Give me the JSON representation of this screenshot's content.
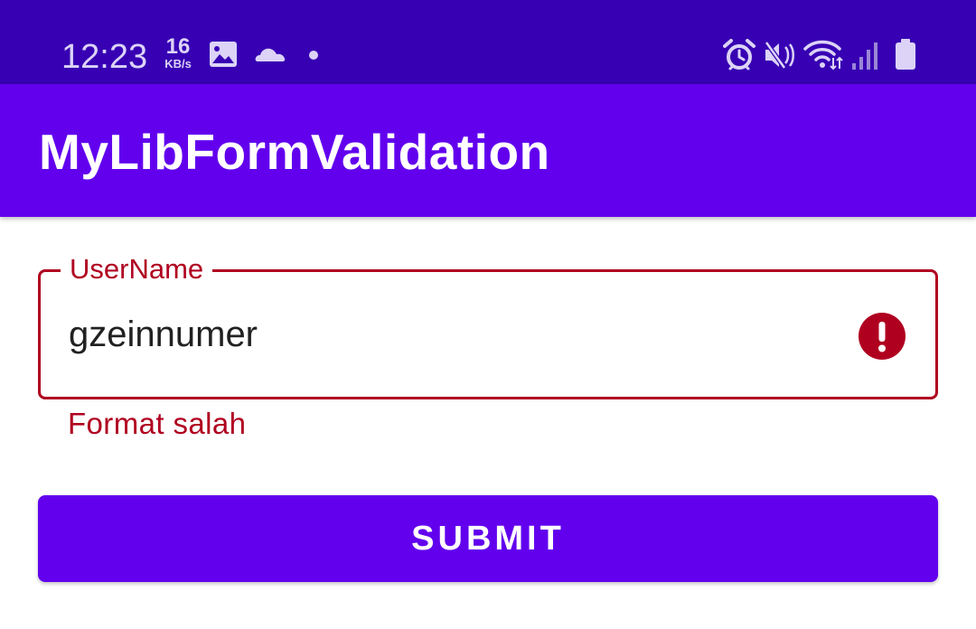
{
  "status_bar": {
    "time": "12:23",
    "net_speed_value": "16",
    "net_speed_unit": "KB/s",
    "left_icons": [
      "image-icon",
      "cloud-icon",
      "dot-icon"
    ],
    "right_icons": [
      "alarm-icon",
      "mute-icon",
      "wifi-icon",
      "signal-icon",
      "battery-icon"
    ]
  },
  "app_bar": {
    "title": "MyLibFormValidation"
  },
  "form": {
    "username": {
      "label": "UserName",
      "value": "gzeinnumer",
      "error_text": "Format salah",
      "state": "error"
    },
    "submit_label": "SUBMIT"
  },
  "colors": {
    "status_bar": "#3700B3",
    "primary": "#6200EE",
    "error": "#B00020",
    "text": "#212121"
  }
}
